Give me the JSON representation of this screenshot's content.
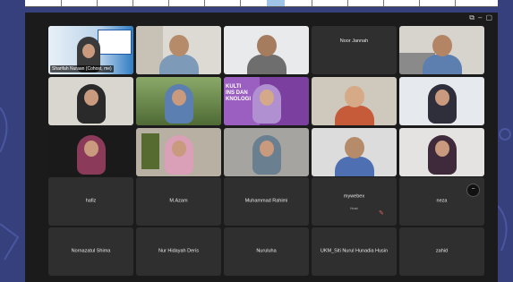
{
  "tiles": [
    {
      "label": "Sharifah Nuraan (Cohost, me)"
    },
    {
      "label": ""
    },
    {
      "label": ""
    },
    {
      "name": "Noor Jannah"
    },
    {
      "label": ""
    },
    {
      "label": ""
    },
    {
      "label": ""
    },
    {
      "label": ""
    },
    {
      "label": ""
    },
    {
      "label": ""
    },
    {
      "label": ""
    },
    {
      "label": ""
    },
    {
      "label": ""
    },
    {
      "label": ""
    },
    {
      "label": ""
    },
    {
      "name": "hafiz"
    },
    {
      "name": "M.Azam"
    },
    {
      "name": "Muhammad Rahimi"
    },
    {
      "name": "mywebex",
      "sub": "Host"
    },
    {
      "name": "neza"
    },
    {
      "name": "Nornazatul Shima"
    },
    {
      "name": "Nur Hidayah Deris"
    },
    {
      "name": "Nuruluha"
    },
    {
      "name": "UKM_Siti Nurul Hunadia Husin"
    },
    {
      "name": "zahid"
    }
  ],
  "banner_text": "KULTI\nINS DAN\nKNOLOGI",
  "colors": {
    "active_border": "#4caf50",
    "tile_bg": "#2f2f2f",
    "window_bg": "#1b1b1b",
    "desktop_bg": "#35407c"
  }
}
